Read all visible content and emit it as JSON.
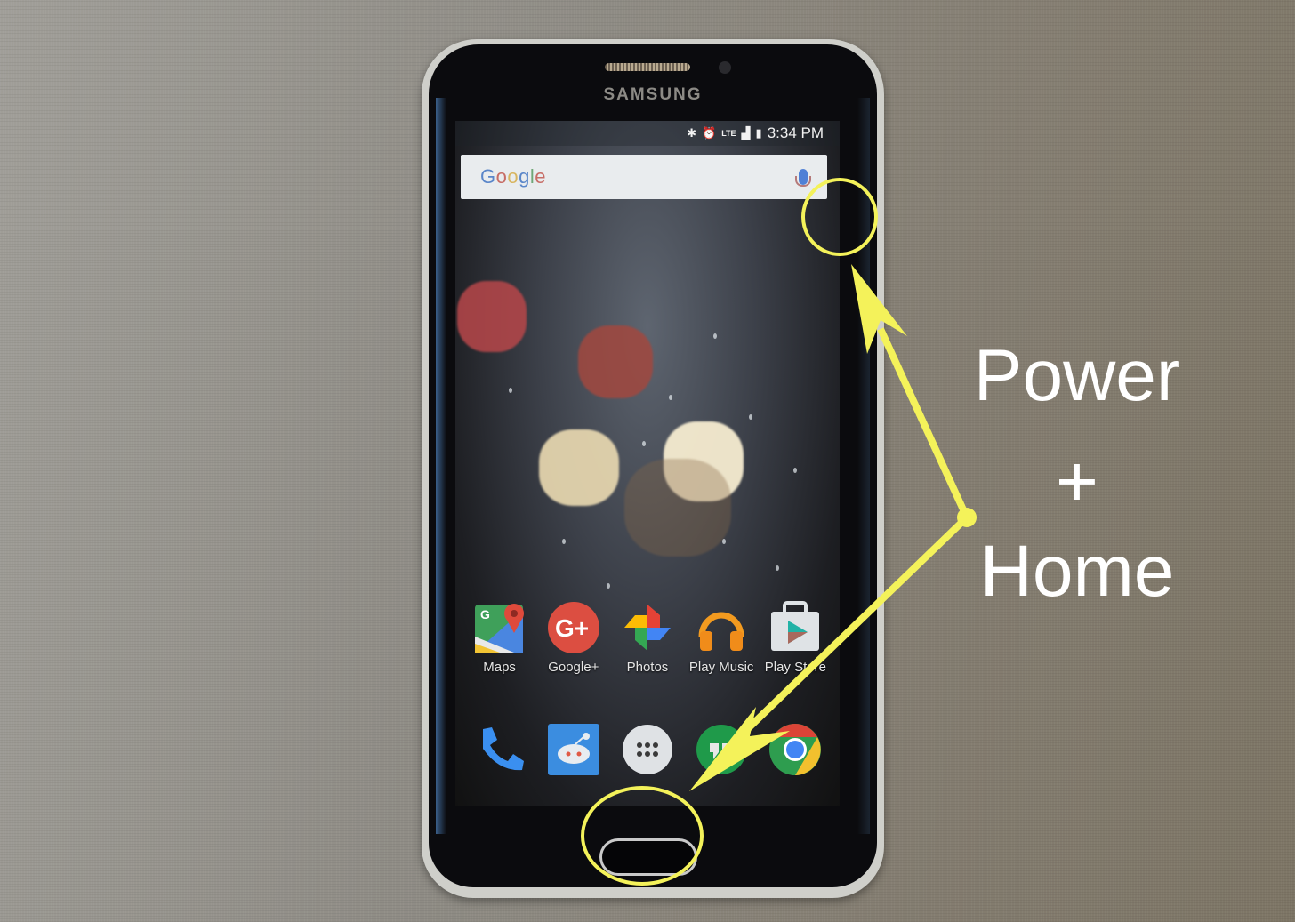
{
  "device": {
    "brand": "SAMSUNG",
    "model_kind": "smartphone"
  },
  "status_bar": {
    "icons": [
      "bluetooth-icon",
      "alarm-icon",
      "lte-icon",
      "signal-icon",
      "battery-icon"
    ],
    "network": "LTE",
    "time": "3:34 PM"
  },
  "search_widget": {
    "logo": "Google",
    "mic_icon": "mic-icon"
  },
  "home_screen": {
    "apps": [
      {
        "label": "Maps",
        "icon": "maps-icon"
      },
      {
        "label": "Google+",
        "icon": "google-plus-icon"
      },
      {
        "label": "Photos",
        "icon": "photos-icon"
      },
      {
        "label": "Play Music",
        "icon": "play-music-icon"
      },
      {
        "label": "Play Store",
        "icon": "play-store-icon"
      }
    ],
    "dock": [
      {
        "name": "Phone",
        "icon": "phone-icon"
      },
      {
        "name": "Reddit",
        "icon": "reddit-icon"
      },
      {
        "name": "App Drawer",
        "icon": "app-drawer-icon"
      },
      {
        "name": "Hangouts",
        "icon": "hangouts-icon"
      },
      {
        "name": "Chrome",
        "icon": "chrome-icon"
      }
    ]
  },
  "annotation": {
    "line1": "Power",
    "line2": "+",
    "line3": "Home",
    "highlight_color": "#f4f25a",
    "targets": [
      "power-button",
      "home-button"
    ]
  }
}
